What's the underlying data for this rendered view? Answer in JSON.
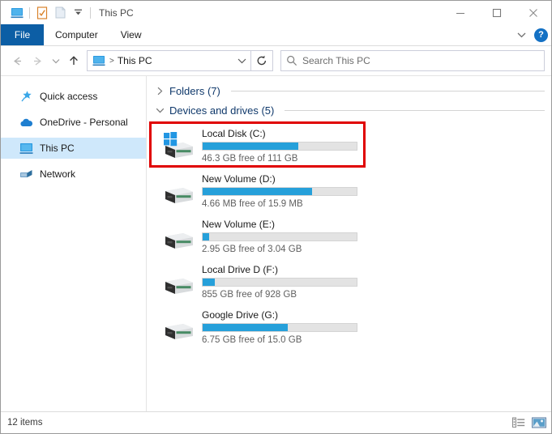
{
  "window": {
    "title": "This PC",
    "quick_access_toolbar": [
      {
        "name": "this-pc-icon",
        "label": "This PC"
      },
      {
        "name": "properties-icon",
        "label": "Properties"
      },
      {
        "name": "new-folder-icon",
        "label": "New folder"
      },
      {
        "name": "customize-qat-chevron-icon",
        "label": "Customize Quick Access Toolbar"
      }
    ],
    "controls": {
      "minimize": "Minimize",
      "maximize": "Maximize",
      "close": "Close"
    }
  },
  "ribbon": {
    "tabs": [
      {
        "label": "File",
        "selected": true
      },
      {
        "label": "Computer",
        "selected": false
      },
      {
        "label": "View",
        "selected": false
      }
    ],
    "expand_label": "Expand the Ribbon",
    "help_label": "?"
  },
  "navigation": {
    "back_label": "Back",
    "forward_label": "Forward",
    "recent_label": "Recent locations",
    "up_label": "Up",
    "breadcrumb": {
      "icon": "this-pc-icon",
      "separator": ">",
      "text": "This PC"
    },
    "address_dropdown_label": "Previous locations",
    "refresh_label": "Refresh"
  },
  "search": {
    "icon": "search-icon",
    "placeholder": "Search This PC",
    "value": ""
  },
  "sidebar": {
    "items": [
      {
        "label": "Quick access",
        "icon": "star-pin-icon",
        "selected": false
      },
      {
        "label": "OneDrive - Personal",
        "icon": "cloud-icon",
        "selected": false
      },
      {
        "label": "This PC",
        "icon": "this-pc-icon",
        "selected": true
      },
      {
        "label": "Network",
        "icon": "network-icon",
        "selected": false
      }
    ]
  },
  "content": {
    "groups": [
      {
        "label": "Folders (7)",
        "expanded": false,
        "chevron": "chevron-right-icon"
      },
      {
        "label": "Devices and drives (5)",
        "expanded": true,
        "chevron": "chevron-down-icon"
      }
    ],
    "drives": [
      {
        "name": "Local Disk (C:)",
        "free_text": "46.3 GB free of 111 GB",
        "used_percent": 62,
        "icon": "windows-drive-icon",
        "highlighted": true
      },
      {
        "name": "New Volume (D:)",
        "free_text": "4.66 MB free of 15.9 MB",
        "used_percent": 71,
        "icon": "drive-icon",
        "highlighted": false
      },
      {
        "name": "New Volume (E:)",
        "free_text": "2.95 GB free of 3.04 GB",
        "used_percent": 4,
        "icon": "drive-icon",
        "highlighted": false
      },
      {
        "name": "Local Drive D (F:)",
        "free_text": "855 GB free of 928 GB",
        "used_percent": 8,
        "icon": "drive-icon",
        "highlighted": false
      },
      {
        "name": "Google Drive (G:)",
        "free_text": "6.75 GB free of 15.0 GB",
        "used_percent": 55,
        "icon": "drive-icon",
        "highlighted": false
      }
    ]
  },
  "statusbar": {
    "item_count": "12 items",
    "views": [
      {
        "name": "details-view-button",
        "label": "Details view"
      },
      {
        "name": "large-icons-view-button",
        "label": "Large icons view"
      }
    ]
  },
  "colors": {
    "accent_blue": "#26a0da",
    "file_tab_blue": "#0c5ea5",
    "group_header_blue": "#10396b",
    "highlight_red": "#e00000",
    "selection_blue": "#cfe8fb"
  }
}
